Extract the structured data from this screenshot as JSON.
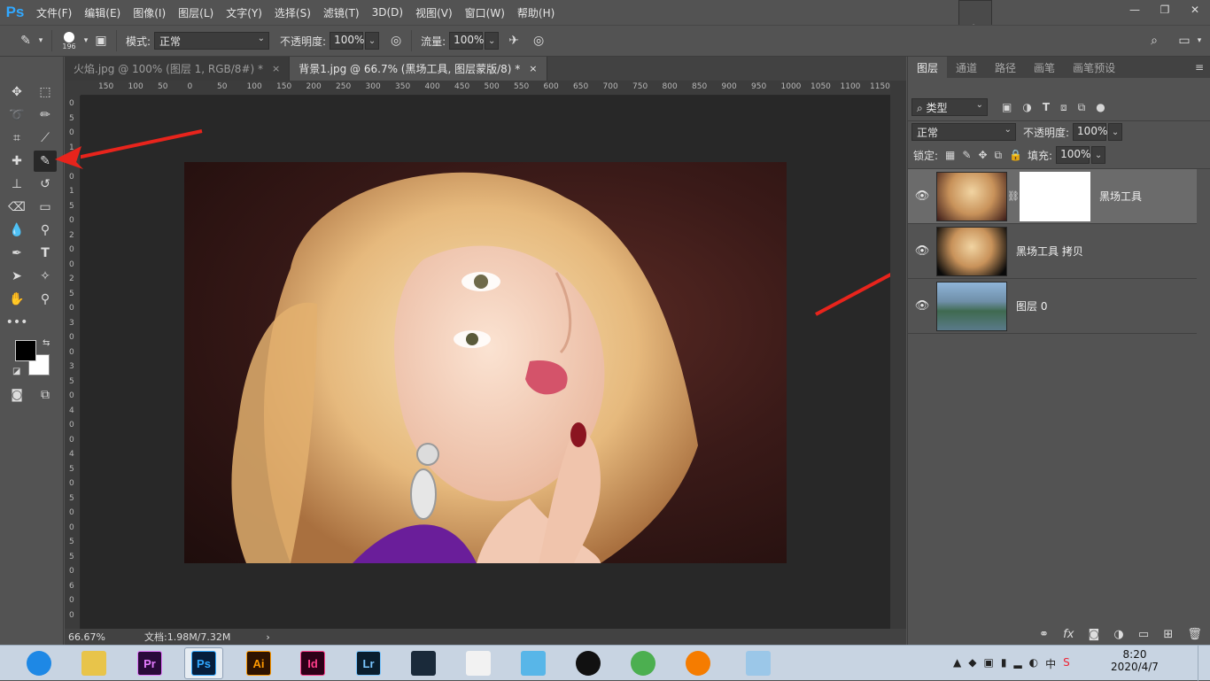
{
  "app": {
    "logo": "Ps"
  },
  "menu": [
    "文件(F)",
    "编辑(E)",
    "图像(I)",
    "图层(L)",
    "文字(Y)",
    "选择(S)",
    "滤镜(T)",
    "3D(D)",
    "视图(V)",
    "窗口(W)",
    "帮助(H)"
  ],
  "options": {
    "brush_size": "196",
    "mode_label": "模式:",
    "mode_value": "正常",
    "opacity_label": "不透明度:",
    "opacity_value": "100%",
    "flow_label": "流量:",
    "flow_value": "100%"
  },
  "tabs": [
    {
      "label": "火焰.jpg @ 100% (图层 1, RGB/8#) *",
      "close": "×"
    },
    {
      "label": "背景1.jpg @ 66.7% (黑场工具, 图层蒙版/8) *",
      "close": "×"
    }
  ],
  "ruler_h": [
    "150",
    "100",
    "50",
    "0",
    "50",
    "100",
    "150",
    "200",
    "250",
    "300",
    "350",
    "400",
    "450",
    "500",
    "550",
    "600",
    "650",
    "700",
    "750",
    "800",
    "850",
    "900",
    "950",
    "1000",
    "1050",
    "1100",
    "1150"
  ],
  "ruler_v": [
    "0",
    "5",
    "0",
    "1",
    "0",
    "0",
    "1",
    "5",
    "0",
    "2",
    "0",
    "0",
    "2",
    "5",
    "0",
    "3",
    "0",
    "0",
    "3",
    "5",
    "0",
    "4",
    "0",
    "0",
    "4",
    "5",
    "0",
    "5",
    "0",
    "0",
    "5",
    "5",
    "0",
    "6",
    "0",
    "0"
  ],
  "status": {
    "zoom": "66.67%",
    "doc": "文档:1.98M/7.32M"
  },
  "panel": {
    "tabs": [
      "图层",
      "通道",
      "路径",
      "画笔",
      "画笔预设"
    ],
    "filter_label": "类型",
    "blend_mode": "正常",
    "opacity_label": "不透明度:",
    "opacity_value": "100%",
    "lock_label": "锁定:",
    "fill_label": "填充:",
    "fill_value": "100%",
    "layers": [
      {
        "name": "黑场工具",
        "selected": true
      },
      {
        "name": "黑场工具 拷贝",
        "selected": false
      },
      {
        "name": "图层 0",
        "selected": false
      }
    ]
  },
  "taskbar": {
    "apps": [
      {
        "name": "ie",
        "label": "",
        "color": "#1e88e5"
      },
      {
        "name": "explorer",
        "label": "",
        "color": "#e8c44a"
      },
      {
        "name": "premiere",
        "label": "Pr",
        "color": "#2a0a3a",
        "fg": "#e57cff"
      },
      {
        "name": "photoshop",
        "label": "Ps",
        "color": "#061e3c",
        "fg": "#31a8ff"
      },
      {
        "name": "illustrator",
        "label": "Ai",
        "color": "#2e1300",
        "fg": "#ff9a00"
      },
      {
        "name": "indesign",
        "label": "Id",
        "color": "#2d0018",
        "fg": "#ff3d8b"
      },
      {
        "name": "lightroom",
        "label": "Lr",
        "color": "#0a1e2e",
        "fg": "#7ac6ff"
      },
      {
        "name": "video-editor",
        "label": "",
        "color": "#1a2a3a"
      },
      {
        "name": "color-app",
        "label": "",
        "color": "#f2f2f2"
      },
      {
        "name": "cat-app",
        "label": "",
        "color": "#58b6e8"
      },
      {
        "name": "qq",
        "label": "",
        "color": "#111111"
      },
      {
        "name": "chrome",
        "label": "",
        "color": "#4caf50"
      },
      {
        "name": "browser-fox",
        "label": "",
        "color": "#f57c00"
      },
      {
        "name": "notes",
        "label": "",
        "color": "#9bc7e8"
      }
    ],
    "time": "8:20",
    "date": "2020/4/7",
    "ime": "中"
  }
}
